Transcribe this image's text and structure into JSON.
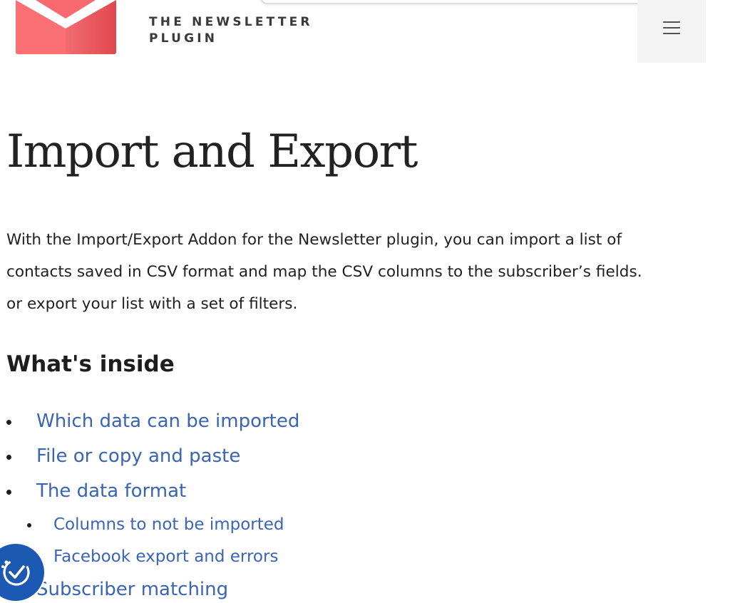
{
  "header": {
    "brand_line1": "THE NEWSLETTER",
    "brand_line2": "PLUGIN",
    "logo_icon": "envelope-logo-icon",
    "menu_icon": "hamburger-menu-icon",
    "brand_color": "#f55b63"
  },
  "content": {
    "title": "Import and Export",
    "intro_lines": [
      "With the Import/Export Addon for the Newsletter plugin, you can import a list of",
      "contacts saved in CSV format and map the CSV columns to the subscriber’s fields.",
      "or export your list with a set of filters."
    ],
    "section_heading": "What's inside",
    "toc": [
      {
        "label": "Which data can be imported",
        "level": 1
      },
      {
        "label": "File or copy and paste",
        "level": 1
      },
      {
        "label": "The data format",
        "level": 1
      },
      {
        "label": "Columns to not be imported",
        "level": 2
      },
      {
        "label": "Facebook export and errors",
        "level": 2
      },
      {
        "label": "Subscriber matching",
        "level": 1
      }
    ],
    "link_color": "#3a64b4"
  },
  "accessibility_widget": {
    "icon": "accessibility-check-icon",
    "color": "#1c59b3"
  }
}
